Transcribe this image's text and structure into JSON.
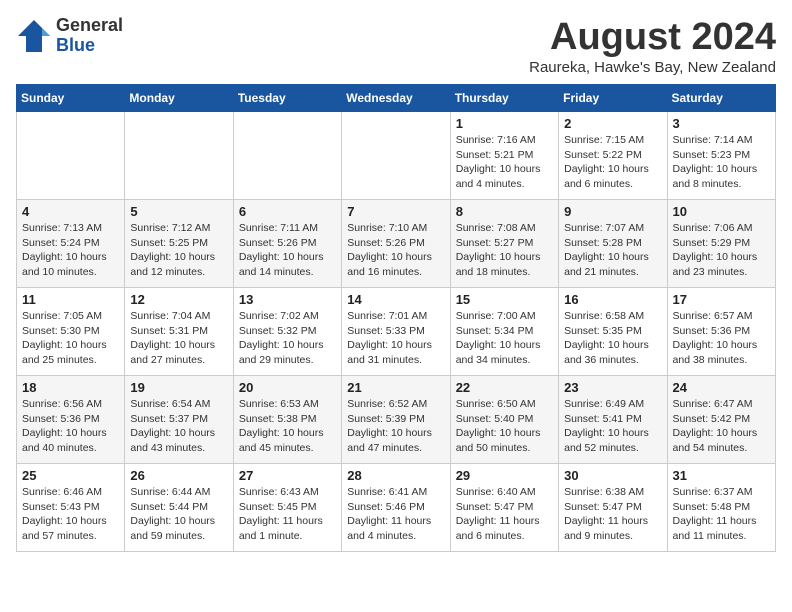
{
  "logo": {
    "general": "General",
    "blue": "Blue"
  },
  "title": "August 2024",
  "subtitle": "Raureka, Hawke's Bay, New Zealand",
  "days_header": [
    "Sunday",
    "Monday",
    "Tuesday",
    "Wednesday",
    "Thursday",
    "Friday",
    "Saturday"
  ],
  "weeks": [
    [
      {
        "day": "",
        "info": ""
      },
      {
        "day": "",
        "info": ""
      },
      {
        "day": "",
        "info": ""
      },
      {
        "day": "",
        "info": ""
      },
      {
        "day": "1",
        "info": "Sunrise: 7:16 AM\nSunset: 5:21 PM\nDaylight: 10 hours\nand 4 minutes."
      },
      {
        "day": "2",
        "info": "Sunrise: 7:15 AM\nSunset: 5:22 PM\nDaylight: 10 hours\nand 6 minutes."
      },
      {
        "day": "3",
        "info": "Sunrise: 7:14 AM\nSunset: 5:23 PM\nDaylight: 10 hours\nand 8 minutes."
      }
    ],
    [
      {
        "day": "4",
        "info": "Sunrise: 7:13 AM\nSunset: 5:24 PM\nDaylight: 10 hours\nand 10 minutes."
      },
      {
        "day": "5",
        "info": "Sunrise: 7:12 AM\nSunset: 5:25 PM\nDaylight: 10 hours\nand 12 minutes."
      },
      {
        "day": "6",
        "info": "Sunrise: 7:11 AM\nSunset: 5:26 PM\nDaylight: 10 hours\nand 14 minutes."
      },
      {
        "day": "7",
        "info": "Sunrise: 7:10 AM\nSunset: 5:26 PM\nDaylight: 10 hours\nand 16 minutes."
      },
      {
        "day": "8",
        "info": "Sunrise: 7:08 AM\nSunset: 5:27 PM\nDaylight: 10 hours\nand 18 minutes."
      },
      {
        "day": "9",
        "info": "Sunrise: 7:07 AM\nSunset: 5:28 PM\nDaylight: 10 hours\nand 21 minutes."
      },
      {
        "day": "10",
        "info": "Sunrise: 7:06 AM\nSunset: 5:29 PM\nDaylight: 10 hours\nand 23 minutes."
      }
    ],
    [
      {
        "day": "11",
        "info": "Sunrise: 7:05 AM\nSunset: 5:30 PM\nDaylight: 10 hours\nand 25 minutes."
      },
      {
        "day": "12",
        "info": "Sunrise: 7:04 AM\nSunset: 5:31 PM\nDaylight: 10 hours\nand 27 minutes."
      },
      {
        "day": "13",
        "info": "Sunrise: 7:02 AM\nSunset: 5:32 PM\nDaylight: 10 hours\nand 29 minutes."
      },
      {
        "day": "14",
        "info": "Sunrise: 7:01 AM\nSunset: 5:33 PM\nDaylight: 10 hours\nand 31 minutes."
      },
      {
        "day": "15",
        "info": "Sunrise: 7:00 AM\nSunset: 5:34 PM\nDaylight: 10 hours\nand 34 minutes."
      },
      {
        "day": "16",
        "info": "Sunrise: 6:58 AM\nSunset: 5:35 PM\nDaylight: 10 hours\nand 36 minutes."
      },
      {
        "day": "17",
        "info": "Sunrise: 6:57 AM\nSunset: 5:36 PM\nDaylight: 10 hours\nand 38 minutes."
      }
    ],
    [
      {
        "day": "18",
        "info": "Sunrise: 6:56 AM\nSunset: 5:36 PM\nDaylight: 10 hours\nand 40 minutes."
      },
      {
        "day": "19",
        "info": "Sunrise: 6:54 AM\nSunset: 5:37 PM\nDaylight: 10 hours\nand 43 minutes."
      },
      {
        "day": "20",
        "info": "Sunrise: 6:53 AM\nSunset: 5:38 PM\nDaylight: 10 hours\nand 45 minutes."
      },
      {
        "day": "21",
        "info": "Sunrise: 6:52 AM\nSunset: 5:39 PM\nDaylight: 10 hours\nand 47 minutes."
      },
      {
        "day": "22",
        "info": "Sunrise: 6:50 AM\nSunset: 5:40 PM\nDaylight: 10 hours\nand 50 minutes."
      },
      {
        "day": "23",
        "info": "Sunrise: 6:49 AM\nSunset: 5:41 PM\nDaylight: 10 hours\nand 52 minutes."
      },
      {
        "day": "24",
        "info": "Sunrise: 6:47 AM\nSunset: 5:42 PM\nDaylight: 10 hours\nand 54 minutes."
      }
    ],
    [
      {
        "day": "25",
        "info": "Sunrise: 6:46 AM\nSunset: 5:43 PM\nDaylight: 10 hours\nand 57 minutes."
      },
      {
        "day": "26",
        "info": "Sunrise: 6:44 AM\nSunset: 5:44 PM\nDaylight: 10 hours\nand 59 minutes."
      },
      {
        "day": "27",
        "info": "Sunrise: 6:43 AM\nSunset: 5:45 PM\nDaylight: 11 hours\nand 1 minute."
      },
      {
        "day": "28",
        "info": "Sunrise: 6:41 AM\nSunset: 5:46 PM\nDaylight: 11 hours\nand 4 minutes."
      },
      {
        "day": "29",
        "info": "Sunrise: 6:40 AM\nSunset: 5:47 PM\nDaylight: 11 hours\nand 6 minutes."
      },
      {
        "day": "30",
        "info": "Sunrise: 6:38 AM\nSunset: 5:47 PM\nDaylight: 11 hours\nand 9 minutes."
      },
      {
        "day": "31",
        "info": "Sunrise: 6:37 AM\nSunset: 5:48 PM\nDaylight: 11 hours\nand 11 minutes."
      }
    ]
  ]
}
